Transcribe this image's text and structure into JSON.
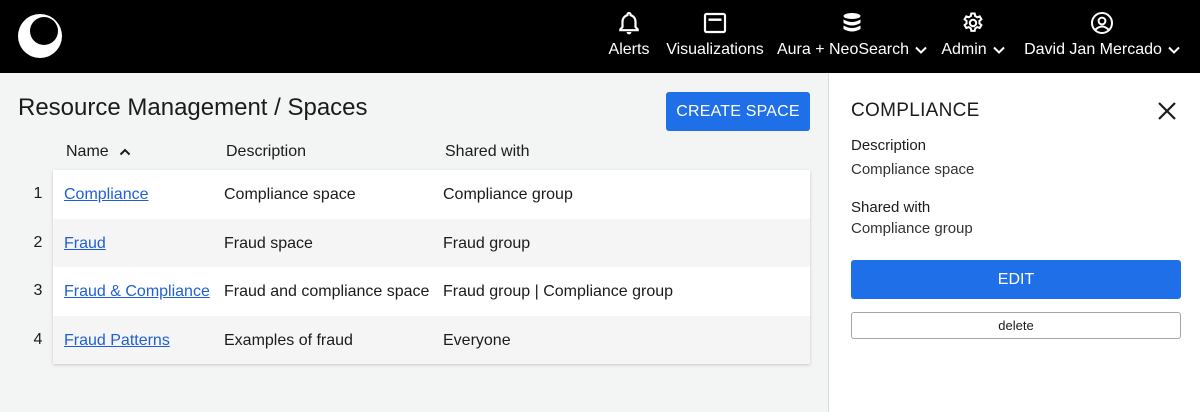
{
  "nav": {
    "alerts": "Alerts",
    "visualizations": "Visualizations",
    "aura": "Aura + NeoSearch",
    "admin": "Admin",
    "user": "David Jan Mercado"
  },
  "icons": {
    "logo": "crescent-logo-icon",
    "alerts": "bell-icon",
    "visualizations": "browser-window-icon",
    "aura": "database-icon",
    "admin": "gear-icon",
    "user": "account-circle-icon",
    "dropdown": "chevron-down-icon",
    "sort": "chevron-up-icon",
    "close": "close-icon"
  },
  "colors": {
    "topbar": "#000000",
    "accent": "#1f6fe8",
    "link": "#1f5fd6"
  },
  "page": {
    "title": "Resource Management / Spaces",
    "create_label": "CREATE SPACE"
  },
  "table": {
    "headers": {
      "name": "Name",
      "description": "Description",
      "shared": "Shared with"
    },
    "sort": {
      "column": "name",
      "direction": "ascending"
    },
    "rows": [
      {
        "num": "1",
        "name": "Compliance",
        "description": "Compliance space",
        "shared": "Compliance group"
      },
      {
        "num": "2",
        "name": "Fraud",
        "description": "Fraud space",
        "shared": "Fraud group"
      },
      {
        "num": "3",
        "name": "Fraud & Compliance",
        "description": "Fraud and compliance space",
        "shared": "Fraud group | Compliance group"
      },
      {
        "num": "4",
        "name": "Fraud Patterns",
        "description": "Examples of fraud",
        "shared": "Everyone"
      }
    ]
  },
  "panel": {
    "title": "COMPLIANCE",
    "description_label": "Description",
    "description_value": "Compliance space",
    "shared_label": "Shared with",
    "shared_value": "Compliance group",
    "edit_label": "EDIT",
    "delete_label": "delete"
  }
}
